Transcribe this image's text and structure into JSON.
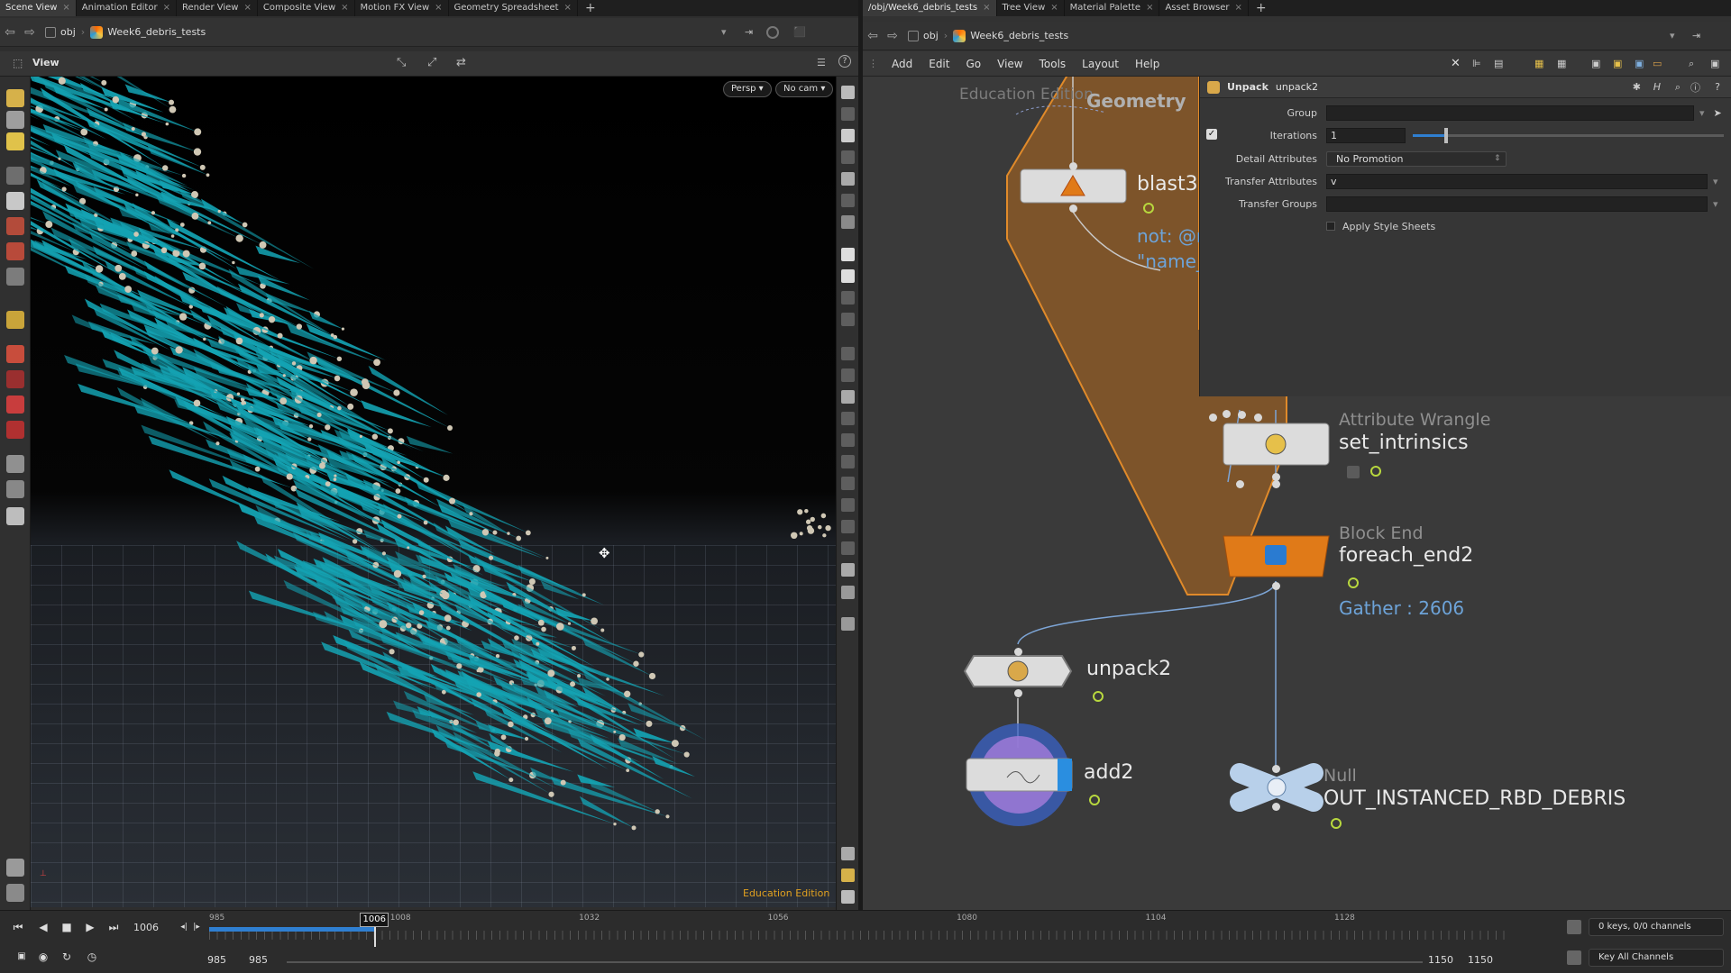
{
  "left_pane": {
    "tabs": [
      "Scene View",
      "Animation Editor",
      "Render View",
      "Composite View",
      "Motion FX View",
      "Geometry Spreadsheet"
    ],
    "path": {
      "network": "obj",
      "node": "Week6_debris_tests"
    },
    "view_label": "View",
    "persp_label": "Persp",
    "cam_label": "No cam",
    "edition_label": "Education Edition"
  },
  "right_pane": {
    "tabs": [
      "/obj/Week6_debris_tests",
      "Tree View",
      "Material Palette",
      "Asset Browser"
    ],
    "path": {
      "network": "obj",
      "node": "Week6_debris_tests"
    },
    "menu": [
      "Add",
      "Edit",
      "Go",
      "View",
      "Tools",
      "Layout",
      "Help"
    ],
    "params": {
      "node_type": "Unpack",
      "node_name": "unpack2",
      "group_label": "Group",
      "group_value": "",
      "iterations_label": "Iterations",
      "iterations_value": "1",
      "iterations_fraction": 0.1,
      "detail_attrs_label": "Detail Attributes",
      "detail_attrs_value": "No Promotion",
      "transfer_attrs_label": "Transfer Attributes",
      "transfer_attrs_value": "v",
      "transfer_groups_label": "Transfer Groups",
      "transfer_groups_value": "",
      "apply_style_label": "Apply Style Sheets"
    },
    "network": {
      "edition_label": "Education Edition",
      "geometry_label": "Geometry",
      "blast_name": "blast3",
      "blast_info_1": "not: @n",
      "blast_info_2": "\"name_",
      "wrangle_type": "Attribute Wrangle",
      "wrangle_name": "set_intrinsics",
      "blockend_type": "Block End",
      "blockend_name": "foreach_end2",
      "blockend_info": "Gather : 2606",
      "unpack_name": "unpack2",
      "add_name": "add2",
      "null_type": "Null",
      "null_name": "OUT_INSTANCED_RBD_DEBRIS"
    }
  },
  "timeline": {
    "current_frame": "1006",
    "marker_frame": "1006",
    "ticks": [
      "985",
      "1008",
      "1032",
      "1056",
      "1080",
      "1104",
      "1128"
    ],
    "range_start": "985",
    "range_start2": "985",
    "range_end": "1150",
    "range_end2": "1150",
    "keys_label": "0 keys, 0/0 channels",
    "key_all_label": "Key All Channels"
  },
  "colors": {
    "debris_cyan": "#14a3b3",
    "debris_chunk": "#cfc7b4",
    "foreach_orange": "#e07a18",
    "network_box": "#b56a1e",
    "info_blue": "#6da3d8"
  }
}
